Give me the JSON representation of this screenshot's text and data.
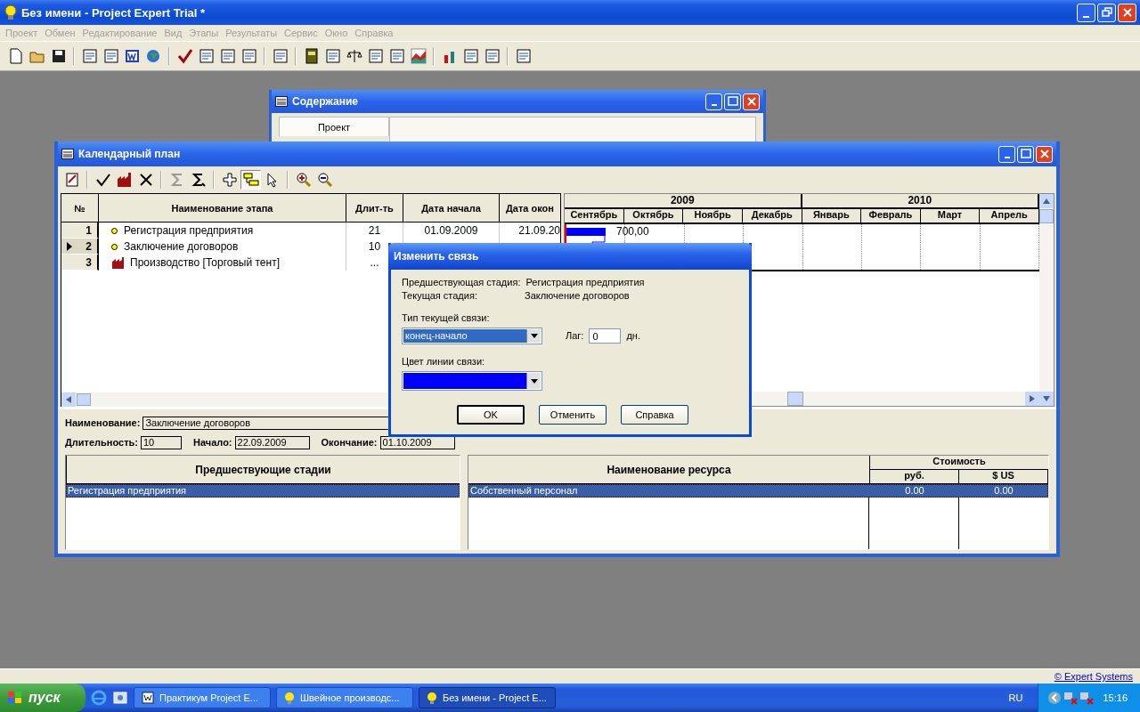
{
  "app_window": {
    "title": "Без имени - Project Expert Trial *"
  },
  "menu": [
    {
      "label": "Проект",
      "disabled": true
    },
    {
      "label": "Обмен",
      "disabled": true
    },
    {
      "label": "Редактирование",
      "disabled": true
    },
    {
      "label": "Вид",
      "disabled": true
    },
    {
      "label": "Этапы",
      "disabled": true
    },
    {
      "label": "Результаты",
      "disabled": true
    },
    {
      "label": "Сервис",
      "disabled": true
    },
    {
      "label": "Окно",
      "disabled": true
    },
    {
      "label": "Справка",
      "disabled": true
    }
  ],
  "content_window": {
    "title": "Содержание",
    "tabs": [
      {
        "label": "Проект",
        "selected": true
      }
    ]
  },
  "calendar_window": {
    "title": "Календарный план",
    "table": {
      "columns": [
        "№",
        "Наименование этапа",
        "Длит-ть",
        "Дата начала",
        "Дата окон"
      ],
      "rows": [
        {
          "num": "1",
          "kind": "stage",
          "name": "Регистрация предприятия",
          "duration": "21",
          "start": "01.09.2009",
          "end": "21.09.20",
          "selected": false
        },
        {
          "num": "2",
          "kind": "stage",
          "name": "Заключение договоров",
          "duration": "10",
          "selected": true
        },
        {
          "num": "3",
          "kind": "product",
          "name": "Производство [Торговый тент]",
          "duration": "...",
          "selected": false
        }
      ]
    },
    "gantt": {
      "years": [
        {
          "label": "2009",
          "months": [
            "Сентябрь",
            "Октябрь",
            "Ноябрь",
            "Декабрь"
          ]
        },
        {
          "label": "2010",
          "months": [
            "Январь",
            "Февраль",
            "Март",
            "Апрель"
          ]
        }
      ],
      "bar_label": "700,00"
    },
    "details": {
      "name_label": "Наименование:",
      "name": "Заключение договоров",
      "duration_label": "Длительность:",
      "duration": "10",
      "start_label": "Начало:",
      "start": "22.09.2009",
      "end_label": "Окончание:",
      "end": "01.10.2009"
    },
    "predecessors": {
      "column": "Предшествующие стадии",
      "rows": [
        {
          "name": "Регистрация предприятия",
          "selected": true
        }
      ]
    },
    "resources": {
      "name_column": "Наименование ресурса",
      "cost_column": "Стоимость",
      "rub_column": "руб.",
      "usd_column": "$ US",
      "rows": [
        {
          "name": "Собственный персонал",
          "rub": "0.00",
          "usd": "0.00",
          "selected": true
        }
      ]
    }
  },
  "dialog": {
    "title": "Изменить связь",
    "predecessor_label": "Предшествующая стадия:",
    "predecessor": "Регистрация предприятия",
    "current_label": "Текущая стадия:",
    "current": "Заключение договоров",
    "link_type_label": "Тип текущей связи:",
    "link_type": "конец-начало",
    "lag_label": "Лаг:",
    "lag": "0",
    "lag_unit": "дн.",
    "line_color_label": "Цвет линии связи:",
    "buttons": [
      {
        "label": "OK",
        "default": true
      },
      {
        "label": "Отменить",
        "default": false
      },
      {
        "label": "Справка",
        "default": false
      }
    ]
  },
  "status_bar": {
    "link": "© Expert Systems"
  },
  "taskbar": {
    "start": "пуск",
    "tasks": [
      {
        "label": "Практикум Project E...",
        "kind": "document",
        "selected": false
      },
      {
        "label": "Швейное производс...",
        "kind": "app",
        "selected": false
      },
      {
        "label": "Без имени - Project E...",
        "kind": "app",
        "selected": true
      }
    ],
    "language": "RU",
    "clock": "15:16"
  }
}
